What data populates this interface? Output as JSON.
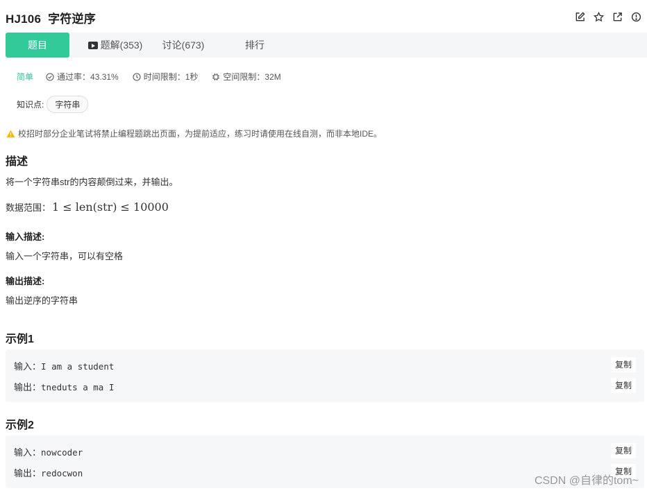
{
  "header": {
    "problem_id": "HJ106",
    "problem_name": "字符逆序",
    "icons": [
      "edit-icon",
      "star-icon",
      "share-icon",
      "report-icon"
    ]
  },
  "tabs": [
    {
      "label": "题目",
      "active": true
    },
    {
      "label": "题解(353)",
      "icon": "video-icon"
    },
    {
      "label": "讨论(673)"
    },
    {
      "label": "排行"
    }
  ],
  "meta": {
    "difficulty": "简单",
    "pass_rate": "通过率：43.31%",
    "time_limit": "时间限制：1秒",
    "memory_limit": "空间限制：32M"
  },
  "knowledge": {
    "label": "知识点:",
    "tags": [
      "字符串"
    ]
  },
  "warning": "校招时部分企业笔试将禁止编程题跳出页面，为提前适应，练习时请使用在线自测，而非本地IDE。",
  "description": {
    "title": "描述",
    "text": "将一个字符串str的内容颠倒过来，并输出。",
    "range_label": "数据范围：",
    "range_math": "1 ≤ len(str) ≤ 10000"
  },
  "input_desc": {
    "title": "输入描述:",
    "text": "输入一个字符串，可以有空格"
  },
  "output_desc": {
    "title": "输出描述:",
    "text": "输出逆序的字符串"
  },
  "examples": [
    {
      "title": "示例1",
      "input_label": "输入：",
      "input": "I am a student",
      "output_label": "输出：",
      "output": "tneduts a ma I",
      "copy_label": "复制"
    },
    {
      "title": "示例2",
      "input_label": "输入：",
      "input": "nowcoder",
      "output_label": "输出：",
      "output": "redocwon",
      "copy_label": "复制"
    }
  ],
  "watermark": "CSDN @自律的tom~",
  "colors": {
    "accent": "#32ca99",
    "tabbar_bg": "#f5f6f8",
    "example_bg": "#f6f7f9",
    "warning": "#f5b800"
  }
}
